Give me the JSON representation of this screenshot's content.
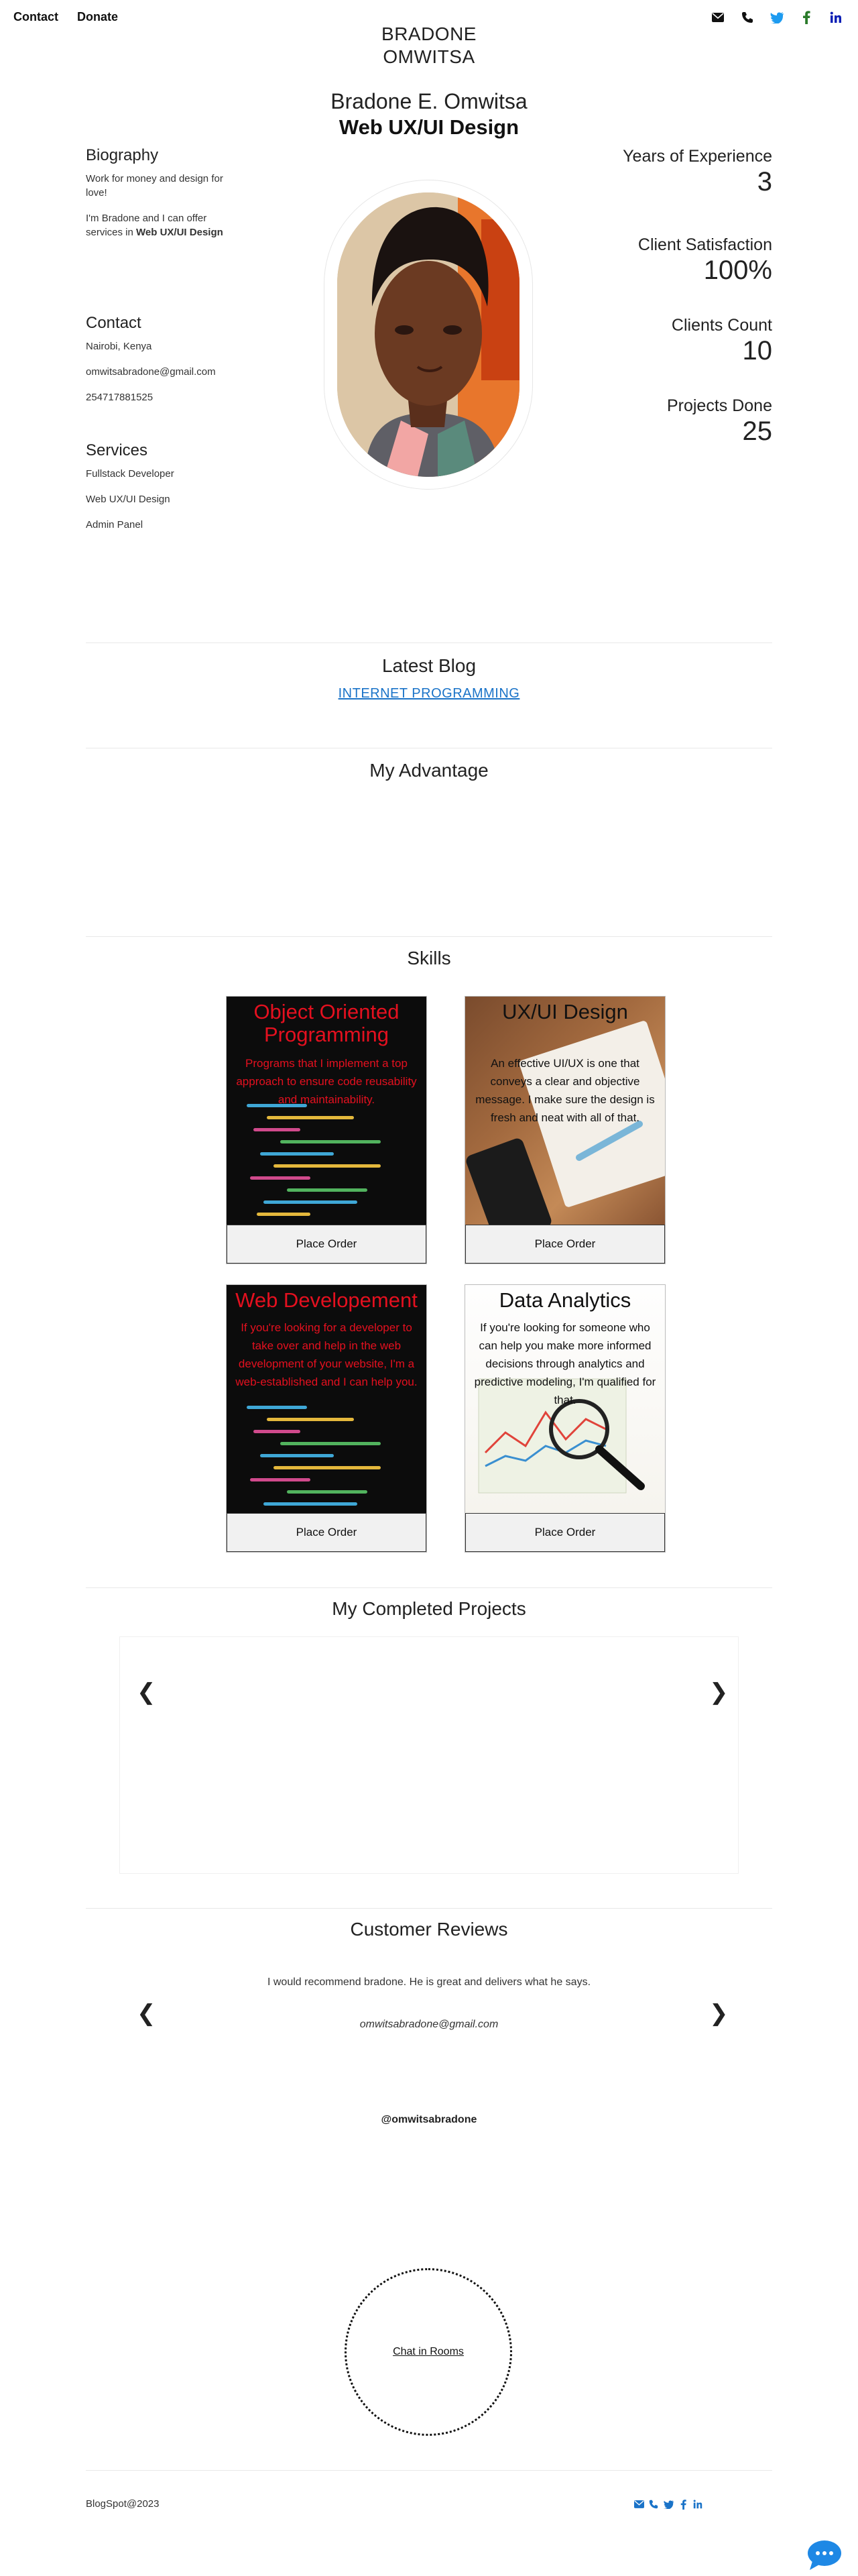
{
  "nav": {
    "contact": "Contact",
    "donate": "Donate"
  },
  "header": {
    "brand_line1": "BRADONE",
    "brand_line2": "OMWITSA",
    "icons": [
      "envelope-icon",
      "phone-icon",
      "twitter-icon",
      "facebook-icon",
      "linkedin-icon"
    ]
  },
  "hero": {
    "name": "Bradone E. Omwitsa",
    "role": "Web UX/UI Design"
  },
  "biography": {
    "title": "Biography",
    "line1": "Work for money and design for love!",
    "line2_prefix": "I'm Bradone and I can offer services in ",
    "line2_bold": "Web UX/UI Design"
  },
  "contact": {
    "title": "Contact",
    "location": "Nairobi, Kenya",
    "email": "omwitsabradone@gmail.com",
    "phone": "254717881525"
  },
  "services": {
    "title": "Services",
    "items": [
      "Fullstack Developer",
      "Web UX/UI Design",
      "Admin Panel"
    ]
  },
  "stats": [
    {
      "label": "Years of Experience",
      "value": "3"
    },
    {
      "label": "Client Satisfaction",
      "value": "100%"
    },
    {
      "label": "Clients Count",
      "value": "10"
    },
    {
      "label": "Projects Done",
      "value": "25"
    }
  ],
  "blog": {
    "title": "Latest Blog",
    "link": "INTERNET PROGRAMMING"
  },
  "advantage": {
    "title": "My Advantage"
  },
  "skills": {
    "title": "Skills",
    "order_label": "Place Order",
    "cards": [
      {
        "title": "Object Oriented Programming",
        "desc": "Programs that I implement a top approach to ensure code reusability and maintainability."
      },
      {
        "title": "UX/UI Design",
        "desc": "An effective UI/UX is one that conveys a clear and objective message. I make sure the design is fresh and neat with all of that."
      },
      {
        "title": "Web Developement",
        "desc": "If you're looking for a developer to take over and help in the web development of your website, I'm a web-established and I can help you."
      },
      {
        "title": "Data Analytics",
        "desc": "If you're looking for someone who can help you make more informed decisions through analytics and predictive modeling, I'm qualified for that."
      }
    ]
  },
  "projects": {
    "title": "My Completed Projects",
    "prev": "❮",
    "next": "❯"
  },
  "reviews": {
    "title": "Customer Reviews",
    "text": "I would recommend bradone. He is great and delivers what he says.",
    "email": "omwitsabradone@gmail.com",
    "prev": "❮",
    "next": "❯"
  },
  "handle": "@omwitsabradone",
  "chat": {
    "label": "Chat in Rooms"
  },
  "footer": {
    "copyright": "BlogSpot@2023"
  },
  "colors": {
    "link": "#1a73c8",
    "skill_red": "#e4101f",
    "twitter": "#1d9bf0",
    "facebook": "#2a7a2a",
    "linkedin": "#0a66c2",
    "fab": "#1e88e5"
  }
}
